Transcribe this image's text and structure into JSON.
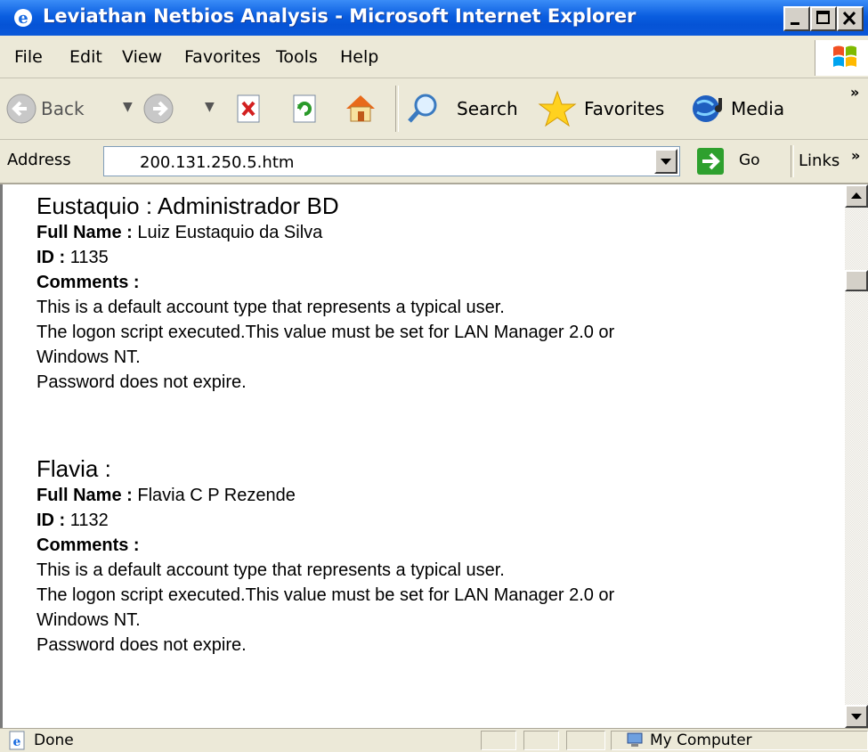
{
  "window": {
    "title": "Leviathan Netbios Analysis - Microsoft Internet Explorer"
  },
  "menu": {
    "items": [
      "File",
      "Edit",
      "View",
      "Favorites",
      "Tools",
      "Help"
    ]
  },
  "toolbar": {
    "back_label": "Back",
    "search_label": "Search",
    "favorites_label": "Favorites",
    "media_label": "Media",
    "overflow": "»"
  },
  "address": {
    "label": "Address",
    "value": "200.131.250.5.htm",
    "go_label": "Go",
    "links_label": "Links",
    "links_overflow": "»"
  },
  "accounts": [
    {
      "title": "Eustaquio : Administrador BD",
      "full_name_label": "Full Name :",
      "full_name": "Luiz Eustaquio da Silva",
      "id_label": "ID :",
      "id": "1135",
      "comments_label": "Comments :",
      "comment_lines": [
        "This is a default account type that represents a typical user.",
        "The logon script executed.This value must be set for LAN Manager 2.0 or",
        "Windows NT.",
        "Password does not expire."
      ]
    },
    {
      "title": "Flavia :",
      "full_name_label": "Full Name :",
      "full_name": "Flavia C P Rezende",
      "id_label": "ID :",
      "id": "1132",
      "comments_label": "Comments :",
      "comment_lines": [
        "This is a default account type that represents a typical user.",
        "The logon script executed.This value must be set for LAN Manager 2.0 or",
        "Windows NT.",
        "Password does not expire."
      ]
    }
  ],
  "status": {
    "text": "Done",
    "zone": "My Computer"
  },
  "colors": {
    "titlebar": "#0a5ee0",
    "chrome": "#ece9d8",
    "content_bg": "#ffffff"
  }
}
